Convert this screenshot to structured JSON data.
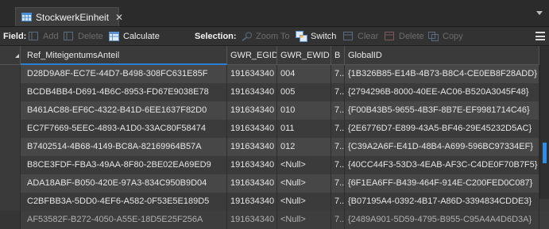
{
  "tab": {
    "title": "StockwerkEinheit",
    "close": "✕"
  },
  "toolbar": {
    "field_label": "Field:",
    "add": "Add",
    "delete": "Delete",
    "calculate": "Calculate",
    "selection_label": "Selection:",
    "zoom_to": "Zoom To",
    "switch": "Switch",
    "clear": "Clear",
    "sel_delete": "Delete",
    "copy": "Copy"
  },
  "columns": [
    "Ref_MiteigentumsAnteil",
    "GWR_EGID",
    "GWR_EWID",
    "B",
    "GlobalID"
  ],
  "rows": [
    [
      "D28D9A8F-EC7E-44D7-B498-308FC631E85F",
      "191634340",
      "004",
      "7...",
      "{1B326B85-E14B-4B73-B8C4-CE0EB8F28ADD}"
    ],
    [
      "BCDB4BB4-D691-4B6C-8953-FD67E9038E78",
      "191634340",
      "005",
      "7...",
      "{2794296B-8000-40EE-AC06-B520A3045F48}"
    ],
    [
      "B461AC88-EF6C-4322-B41D-6EE1637F82D0",
      "191634340",
      "010",
      "7...",
      "{F00B43B5-9655-4B3F-8B7E-EF9981714C46}"
    ],
    [
      "EC7F7669-5EEC-4893-A1D0-33AC80F58474",
      "191634340",
      "011",
      "7...",
      "{2E6776D7-E899-43A5-BF46-29E45232D5AC}"
    ],
    [
      "B7402514-4B68-4149-BC8A-82169964B57A",
      "191634340",
      "012",
      "7...",
      "{C39A2A6F-E41D-48B4-A699-596BC97334EF}"
    ],
    [
      "B8CE3FDF-FBA3-49AA-8F80-2BE02EA69ED9",
      "191634340",
      "<Null>",
      "7...",
      "{40CC44F3-53D3-4EAB-AF3C-C4DE0F70B7F5}"
    ],
    [
      "ADA18ABF-B050-420E-97A3-834C950B9D04",
      "191634340",
      "<Null>",
      "7...",
      "{6F1EA6FF-B439-464F-914E-C200FED0C087}"
    ],
    [
      "C2BFBB3A-5DD0-4EF6-A582-0F53E5E189D5",
      "191634340",
      "<Null>",
      "7...",
      "{B07195A4-0392-4B17-A86D-3394834CDDE3}"
    ],
    [
      "AF53582F-B272-4050-A55E-18D5E25F256A",
      "191634340",
      "<Null>",
      "7...",
      "{2489A901-5D59-4795-B955-C95A4A4D6D3A}"
    ]
  ]
}
